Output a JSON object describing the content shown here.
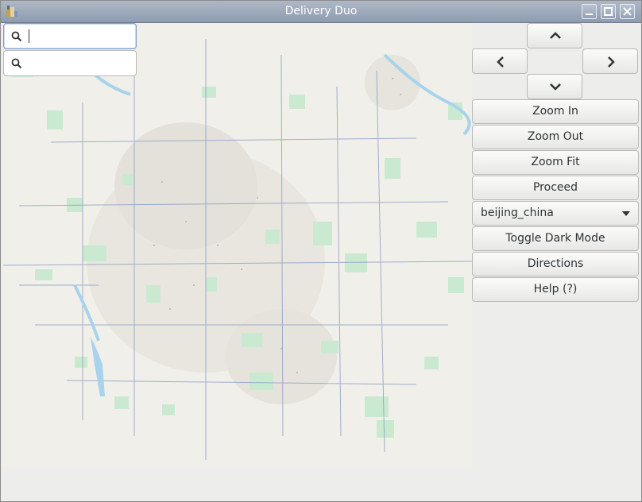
{
  "window": {
    "title": "Delivery Duo"
  },
  "search": {
    "first_value": "",
    "second_value": ""
  },
  "nav": {
    "up_icon": "chevron-up-icon",
    "down_icon": "chevron-down-icon",
    "left_icon": "chevron-left-icon",
    "right_icon": "chevron-right-icon"
  },
  "buttons": {
    "zoom_in": "Zoom In",
    "zoom_out": "Zoom Out",
    "zoom_fit": "Zoom Fit",
    "proceed": "Proceed",
    "toggle_dark_mode": "Toggle Dark Mode",
    "directions": "Directions",
    "help": "Help (?)"
  },
  "map_selector": {
    "selected": "beijing_china"
  },
  "colors": {
    "map_background": "#f1efe9",
    "park_green": "#c9ead1",
    "water_blue": "#a8d3ec",
    "road_blue": "#7d94bf"
  }
}
